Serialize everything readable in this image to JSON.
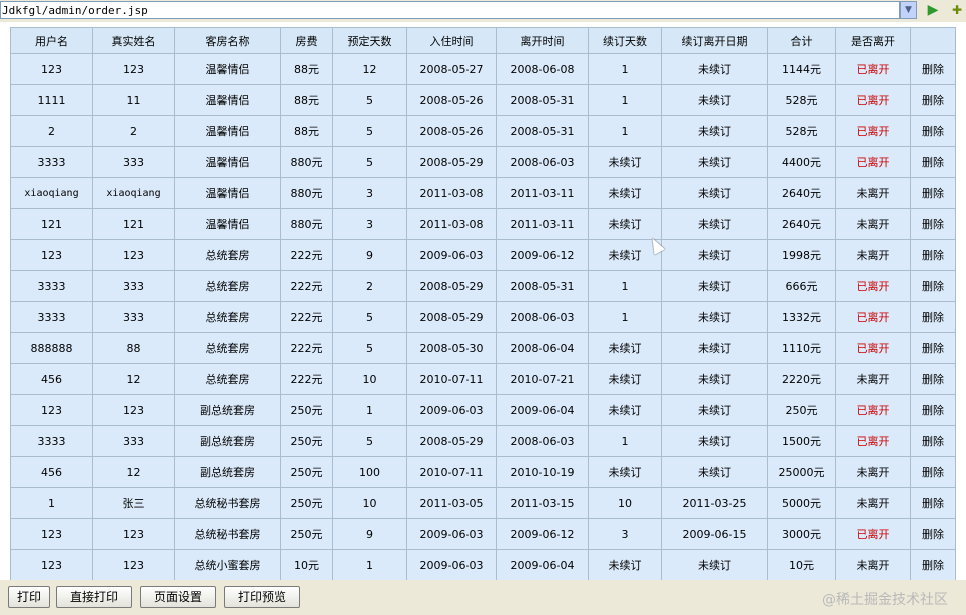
{
  "address_bar": {
    "url": "Jdkfgl/admin/order.jsp"
  },
  "table": {
    "headers": [
      "用户名",
      "真实姓名",
      "客房名称",
      "房费",
      "预定天数",
      "入住时间",
      "离开时间",
      "续订天数",
      "续订离开日期",
      "合计",
      "是否离开",
      ""
    ],
    "rows": [
      [
        "123",
        "123",
        "温馨情侣",
        "88元",
        "12",
        "2008-05-27",
        "2008-06-08",
        "1",
        "未续订",
        "1144元",
        "已离开",
        "删除"
      ],
      [
        "1111",
        "11",
        "温馨情侣",
        "88元",
        "5",
        "2008-05-26",
        "2008-05-31",
        "1",
        "未续订",
        "528元",
        "已离开",
        "删除"
      ],
      [
        "2",
        "2",
        "温馨情侣",
        "88元",
        "5",
        "2008-05-26",
        "2008-05-31",
        "1",
        "未续订",
        "528元",
        "已离开",
        "删除"
      ],
      [
        "3333",
        "333",
        "温馨情侣",
        "880元",
        "5",
        "2008-05-29",
        "2008-06-03",
        "未续订",
        "未续订",
        "4400元",
        "已离开",
        "删除"
      ],
      [
        "xiaoqiang",
        "xiaoqiang",
        "温馨情侣",
        "880元",
        "3",
        "2011-03-08",
        "2011-03-11",
        "未续订",
        "未续订",
        "2640元",
        "未离开",
        "删除"
      ],
      [
        "121",
        "121",
        "温馨情侣",
        "880元",
        "3",
        "2011-03-08",
        "2011-03-11",
        "未续订",
        "未续订",
        "2640元",
        "未离开",
        "删除"
      ],
      [
        "123",
        "123",
        "总统套房",
        "222元",
        "9",
        "2009-06-03",
        "2009-06-12",
        "未续订",
        "未续订",
        "1998元",
        "未离开",
        "删除"
      ],
      [
        "3333",
        "333",
        "总统套房",
        "222元",
        "2",
        "2008-05-29",
        "2008-05-31",
        "1",
        "未续订",
        "666元",
        "已离开",
        "删除"
      ],
      [
        "3333",
        "333",
        "总统套房",
        "222元",
        "5",
        "2008-05-29",
        "2008-06-03",
        "1",
        "未续订",
        "1332元",
        "已离开",
        "删除"
      ],
      [
        "888888",
        "88",
        "总统套房",
        "222元",
        "5",
        "2008-05-30",
        "2008-06-04",
        "未续订",
        "未续订",
        "1110元",
        "已离开",
        "删除"
      ],
      [
        "456",
        "12",
        "总统套房",
        "222元",
        "10",
        "2010-07-11",
        "2010-07-21",
        "未续订",
        "未续订",
        "2220元",
        "未离开",
        "删除"
      ],
      [
        "123",
        "123",
        "副总统套房",
        "250元",
        "1",
        "2009-06-03",
        "2009-06-04",
        "未续订",
        "未续订",
        "250元",
        "已离开",
        "删除"
      ],
      [
        "3333",
        "333",
        "副总统套房",
        "250元",
        "5",
        "2008-05-29",
        "2008-06-03",
        "1",
        "未续订",
        "1500元",
        "已离开",
        "删除"
      ],
      [
        "456",
        "12",
        "副总统套房",
        "250元",
        "100",
        "2010-07-11",
        "2010-10-19",
        "未续订",
        "未续订",
        "25000元",
        "未离开",
        "删除"
      ],
      [
        "1",
        "张三",
        "总统秘书套房",
        "250元",
        "10",
        "2011-03-05",
        "2011-03-15",
        "10",
        "2011-03-25",
        "5000元",
        "未离开",
        "删除"
      ],
      [
        "123",
        "123",
        "总统秘书套房",
        "250元",
        "9",
        "2009-06-03",
        "2009-06-12",
        "3",
        "2009-06-15",
        "3000元",
        "已离开",
        "删除"
      ],
      [
        "123",
        "123",
        "总统小蜜套房",
        "10元",
        "1",
        "2009-06-03",
        "2009-06-04",
        "未续订",
        "未续订",
        "10元",
        "未离开",
        "删除"
      ]
    ]
  },
  "buttons": {
    "print": "打印",
    "direct_print": "直接打印",
    "page_setup": "页面设置",
    "print_preview": "打印预览"
  },
  "watermark": "@稀土掘金技术社区",
  "colors": {
    "left_status": "#cc0000",
    "cell_bg": "#dbeafa",
    "border": "#a9bdd0"
  },
  "icons": {
    "dropdown": "chevron-down-icon",
    "go": "go-arrow-icon"
  }
}
